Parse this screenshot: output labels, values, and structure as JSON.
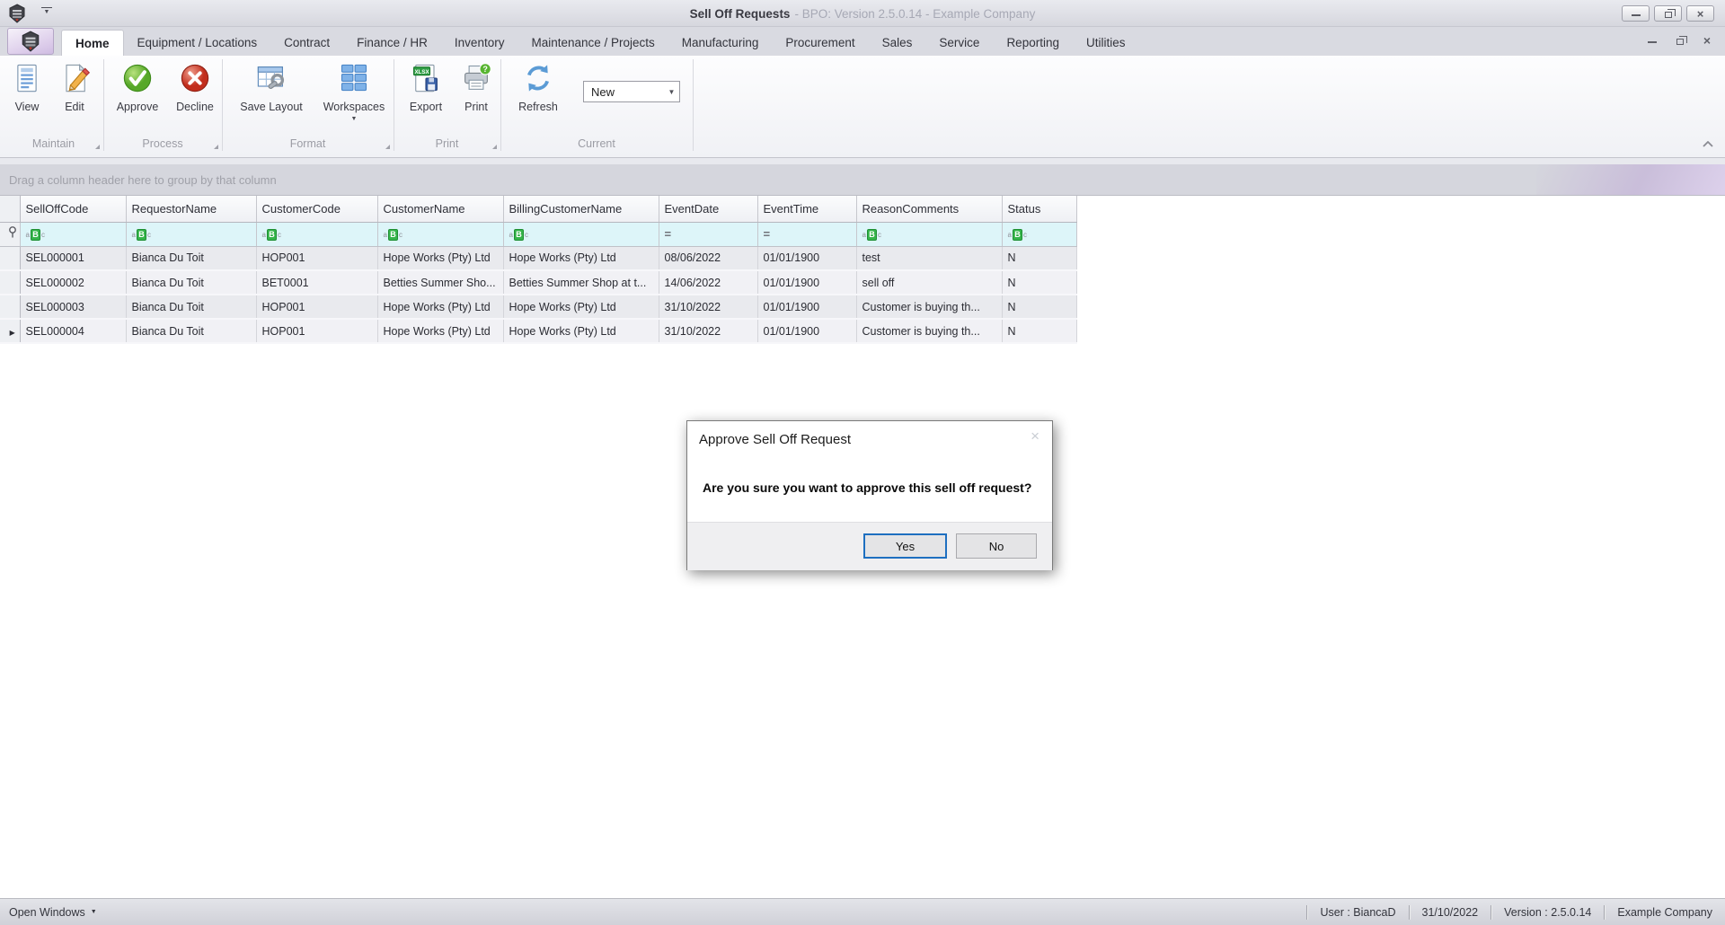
{
  "titlebar": {
    "title": "Sell Off Requests",
    "subtitle": "- BPO: Version 2.5.0.14 - Example Company"
  },
  "tabs": {
    "items": [
      "Home",
      "Equipment / Locations",
      "Contract",
      "Finance / HR",
      "Inventory",
      "Maintenance / Projects",
      "Manufacturing",
      "Procurement",
      "Sales",
      "Service",
      "Reporting",
      "Utilities"
    ],
    "active": "Home"
  },
  "ribbon": {
    "buttons": {
      "view": "View",
      "edit": "Edit",
      "approve": "Approve",
      "decline": "Decline",
      "save_layout": "Save Layout",
      "workspaces": "Workspaces",
      "export": "Export",
      "print": "Print",
      "refresh": "Refresh"
    },
    "groups": {
      "maintain": "Maintain",
      "process": "Process",
      "format": "Format",
      "print": "Print",
      "current": "Current"
    },
    "combo": {
      "value": "New"
    },
    "export_badge": "XLSX"
  },
  "grid": {
    "groupby_hint": "Drag a column header here to group by that column",
    "columns": [
      "SellOffCode",
      "RequestorName",
      "CustomerCode",
      "CustomerName",
      "BillingCustomerName",
      "EventDate",
      "EventTime",
      "ReasonComments",
      "Status"
    ],
    "rows": [
      [
        "SEL000001",
        "Bianca Du Toit",
        "HOP001",
        "Hope Works (Pty) Ltd",
        "Hope Works (Pty) Ltd",
        "08/06/2022",
        "01/01/1900",
        "test",
        "N"
      ],
      [
        "SEL000002",
        "Bianca Du Toit",
        "BET0001",
        "Betties Summer Sho...",
        "Betties Summer Shop at t...",
        "14/06/2022",
        "01/01/1900",
        "sell off",
        "N"
      ],
      [
        "SEL000003",
        "Bianca Du Toit",
        "HOP001",
        "Hope Works (Pty) Ltd",
        "Hope Works (Pty) Ltd",
        "31/10/2022",
        "01/01/1900",
        "Customer is buying th...",
        "N"
      ],
      [
        "SEL000004",
        "Bianca Du Toit",
        "HOP001",
        "Hope Works (Pty) Ltd",
        "Hope Works (Pty) Ltd",
        "31/10/2022",
        "01/01/1900",
        "Customer is buying th...",
        "N"
      ]
    ]
  },
  "dialog": {
    "title": "Approve Sell Off Request",
    "message": "Are you sure you want to approve this sell off request?",
    "yes": "Yes",
    "no": "No"
  },
  "statusbar": {
    "open_windows": "Open Windows",
    "user": "User : BiancaD",
    "date": "31/10/2022",
    "version": "Version : 2.5.0.14",
    "company": "Example Company"
  },
  "icons": {
    "abc_a": "a",
    "abc_b": "B",
    "abc_c": "c",
    "equals": "=",
    "caret": "▼",
    "row_arrow": "▶",
    "close": "×",
    "dialog_close": "×"
  },
  "colors": {
    "approve_green": "#6abf3f",
    "decline_red": "#d23c30",
    "filter_row_cyan": "#ddf5f9",
    "focus_blue": "#1e6fc0",
    "abc_green": "#35b44a",
    "accent_lavender": "#cbb7de"
  }
}
